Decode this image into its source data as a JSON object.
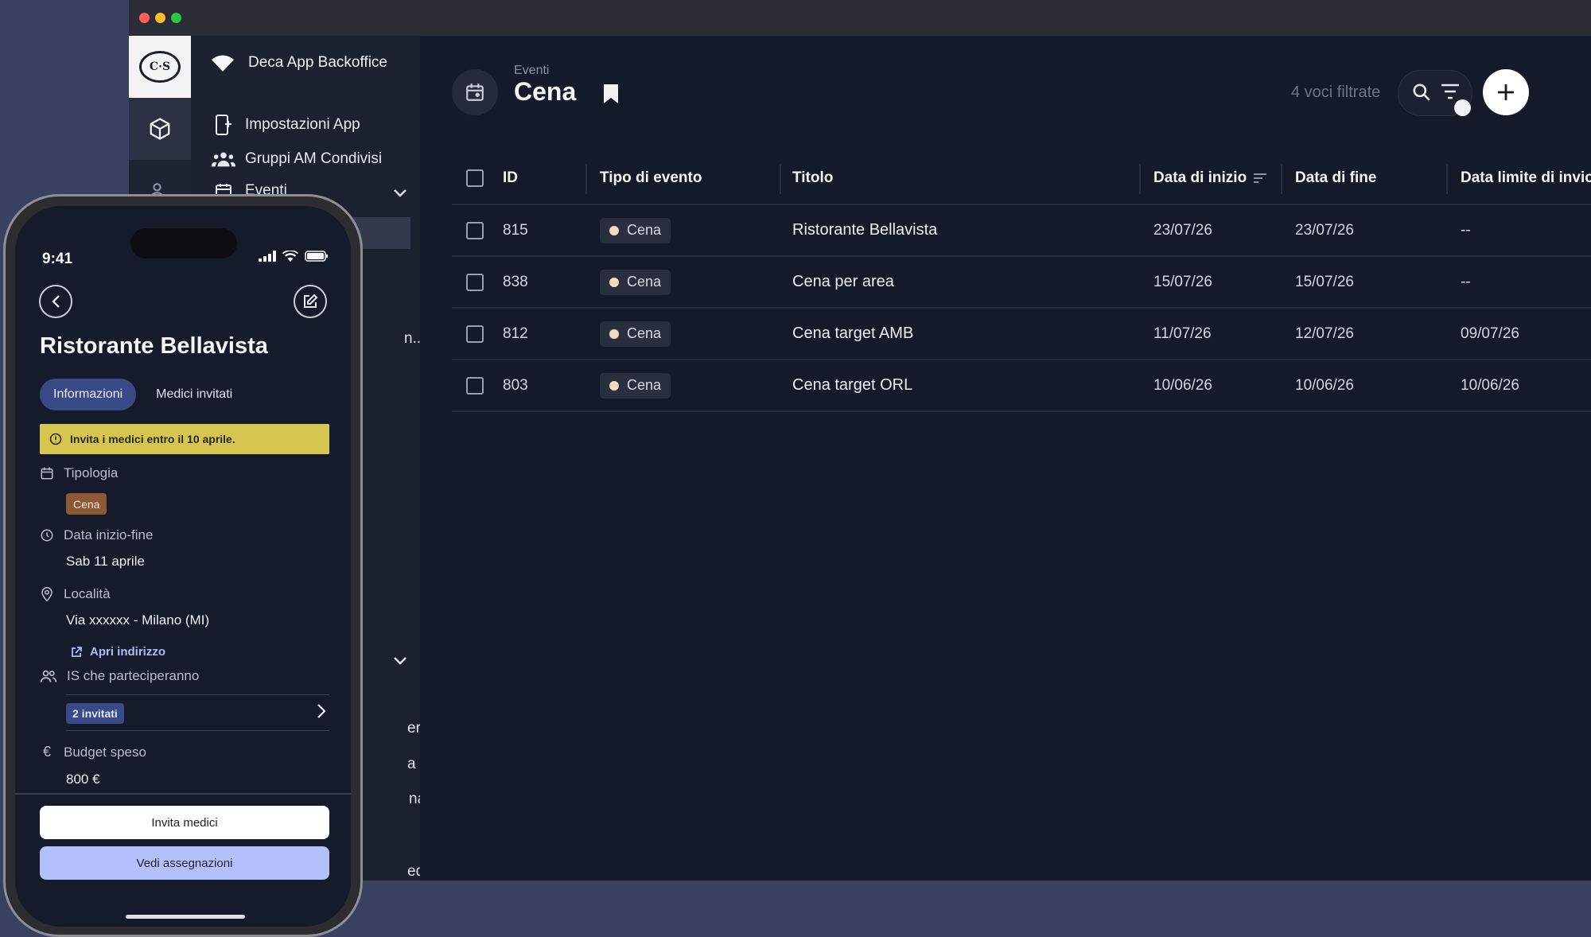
{
  "sidebar": {
    "brand": "Deca App Backoffice",
    "items": [
      {
        "label": "Impostazioni App",
        "icon": "app-settings-icon"
      },
      {
        "label": "Gruppi AM Condivisi",
        "icon": "group-icon"
      },
      {
        "label": "Eventi",
        "icon": "calendar-icon"
      }
    ],
    "peek_labels": [
      "n...",
      "eri",
      "a c...",
      "nali",
      "ed..."
    ]
  },
  "header": {
    "section": "Eventi",
    "title": "Cena",
    "filter_count": "4 voci filtrate"
  },
  "table": {
    "columns": [
      "ID",
      "Tipo di evento",
      "Titolo",
      "Data di inizio",
      "Data di fine",
      "Data limite di invio"
    ],
    "rows": [
      {
        "id": "815",
        "type": "Cena",
        "title": "Ristorante Bellavista",
        "start": "23/07/26",
        "end": "23/07/26",
        "deadline": "--"
      },
      {
        "id": "838",
        "type": "Cena",
        "title": "Cena per area",
        "start": "15/07/26",
        "end": "15/07/26",
        "deadline": "--"
      },
      {
        "id": "812",
        "type": "Cena",
        "title": "Cena target AMB",
        "start": "11/07/26",
        "end": "12/07/26",
        "deadline": "09/07/26"
      },
      {
        "id": "803",
        "type": "Cena",
        "title": "Cena target ORL",
        "start": "10/06/26",
        "end": "10/06/26",
        "deadline": "10/06/26"
      }
    ]
  },
  "phone": {
    "time": "9:41",
    "title": "Ristorante Bellavista",
    "tabs": [
      "Informazioni",
      "Medici invitati"
    ],
    "banner": "Invita i medici entro il 10 aprile.",
    "tipologia_label": "Tipologia",
    "tipologia_value": "Cena",
    "date_label": "Data inizio-fine",
    "date_value": "Sab 11 aprile",
    "location_label": "Località",
    "location_value": "Via xxxxxx - Milano (MI)",
    "open_address": "Apri indirizzo",
    "participants_label": "IS che parteciperanno",
    "participants_value": "2 invitati",
    "budget_label": "Budget speso",
    "budget_value": "800 €",
    "btn_invite": "Invita medici",
    "btn_assign": "Vedi assegnazioni"
  },
  "colors": {
    "accent_blue": "#3a4a86",
    "banner_yellow": "#d6c54e",
    "tag_brown": "#8c5835",
    "button_lavender": "#b3c0fb"
  }
}
